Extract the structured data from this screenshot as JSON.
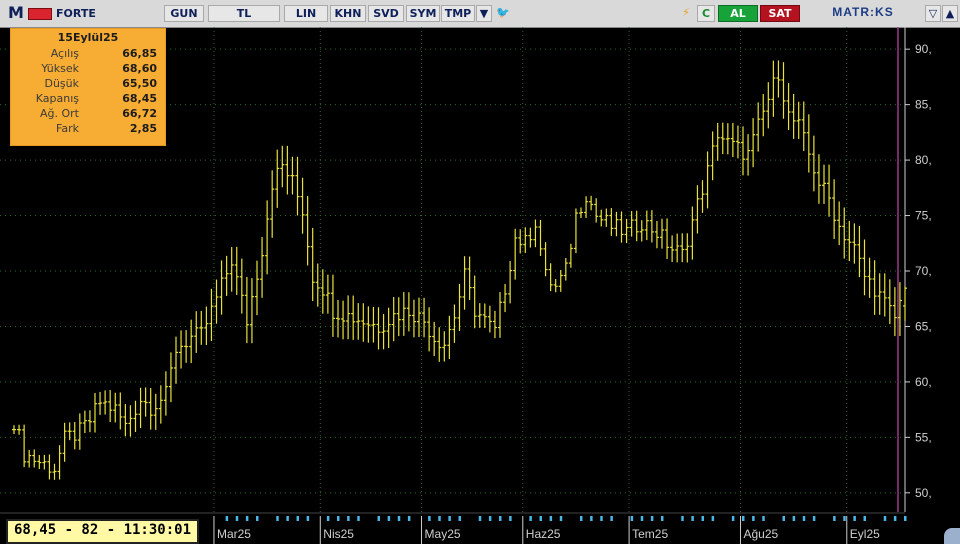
{
  "toolbar": {
    "symbol": "FORTE",
    "items": [
      "GUN",
      "TL",
      "LIN",
      "KHN",
      "SVD",
      "SYM",
      "TMP"
    ],
    "al": "AL",
    "sat": "SAT",
    "brand": "MATR:KS"
  },
  "info": {
    "title": "15Eylül25",
    "rows": [
      {
        "label": "Açılış",
        "value": "66,85"
      },
      {
        "label": "Yüksek",
        "value": "68,60"
      },
      {
        "label": "Düşük",
        "value": "65,50"
      },
      {
        "label": "Kapanış",
        "value": "68,45"
      },
      {
        "label": "Ağ. Ort",
        "value": "66,72"
      },
      {
        "label": "Fark",
        "value": "2,85"
      }
    ]
  },
  "status": "68,45 - 82 - 11:30:01",
  "colors": {
    "price": "#e8e23a",
    "grid": "#2a6b2a",
    "axis": "#cfcfcf",
    "info_bg": "#f7ac34",
    "volume": "#49b6e6",
    "cursor": "#9b3b8c"
  },
  "chart_data": {
    "type": "bar",
    "ylim": [
      48,
      92
    ],
    "yticks": [
      "90,",
      "85,",
      "80,",
      "75,",
      "70,",
      "65,",
      "60,",
      "55,",
      "50,"
    ],
    "ytick_values": [
      90,
      85,
      80,
      75,
      70,
      65,
      60,
      55,
      50
    ],
    "months": [
      "Mar25",
      "Nis25",
      "May25",
      "Haz25",
      "Tem25",
      "Ağu25",
      "Eyl25"
    ],
    "month_starts": [
      40,
      61,
      81,
      101,
      122,
      144,
      165
    ],
    "n": 177,
    "anchors": [
      [
        0,
        56.5
      ],
      [
        2,
        53.5
      ],
      [
        5,
        52.8
      ],
      [
        8,
        52.2
      ],
      [
        10,
        54.8
      ],
      [
        13,
        55.5
      ],
      [
        15,
        56.5
      ],
      [
        17,
        58.2
      ],
      [
        20,
        57.5
      ],
      [
        22,
        56.0
      ],
      [
        25,
        58.5
      ],
      [
        27,
        57.8
      ],
      [
        30,
        58.8
      ],
      [
        32,
        63.0
      ],
      [
        35,
        64.0
      ],
      [
        37,
        64.2
      ],
      [
        40,
        67.5
      ],
      [
        43,
        71.0
      ],
      [
        46,
        65.5
      ],
      [
        49,
        72.0
      ],
      [
        51,
        78.0
      ],
      [
        53,
        79.5
      ],
      [
        55,
        78.0
      ],
      [
        57,
        75.5
      ],
      [
        59,
        69.5
      ],
      [
        61,
        68.5
      ],
      [
        63,
        66.5
      ],
      [
        66,
        66.0
      ],
      [
        69,
        65.5
      ],
      [
        72,
        65.0
      ],
      [
        75,
        66.0
      ],
      [
        78,
        66.5
      ],
      [
        81,
        65.5
      ],
      [
        83,
        64.0
      ],
      [
        85,
        63.5
      ],
      [
        87,
        66.0
      ],
      [
        89,
        69.5
      ],
      [
        91,
        66.5
      ],
      [
        93,
        65.5
      ],
      [
        95,
        64.5
      ],
      [
        97,
        68.5
      ],
      [
        99,
        73.0
      ],
      [
        101,
        72.5
      ],
      [
        103,
        74.5
      ],
      [
        105,
        69.5
      ],
      [
        107,
        68.5
      ],
      [
        109,
        70.0
      ],
      [
        111,
        75.0
      ],
      [
        113,
        77.0
      ],
      [
        115,
        75.0
      ],
      [
        118,
        74.0
      ],
      [
        121,
        73.5
      ],
      [
        124,
        74.5
      ],
      [
        127,
        73.5
      ],
      [
        130,
        72.0
      ],
      [
        132,
        71.5
      ],
      [
        135,
        76.0
      ],
      [
        137,
        79.0
      ],
      [
        139,
        82.5
      ],
      [
        141,
        81.5
      ],
      [
        143,
        81.0
      ],
      [
        145,
        80.5
      ],
      [
        147,
        83.0
      ],
      [
        149,
        85.5
      ],
      [
        151,
        88.0
      ],
      [
        153,
        84.0
      ],
      [
        155,
        83.0
      ],
      [
        157,
        80.5
      ],
      [
        159,
        78.0
      ],
      [
        161,
        76.5
      ],
      [
        163,
        74.0
      ],
      [
        166,
        72.0
      ],
      [
        168,
        69.5
      ],
      [
        170,
        68.5
      ],
      [
        172,
        67.0
      ],
      [
        174,
        65.8
      ],
      [
        176,
        68.45
      ]
    ],
    "last_bar": {
      "date": "15Eylül25",
      "open": 66.85,
      "high": 68.6,
      "low": 65.5,
      "close": 68.45
    }
  }
}
